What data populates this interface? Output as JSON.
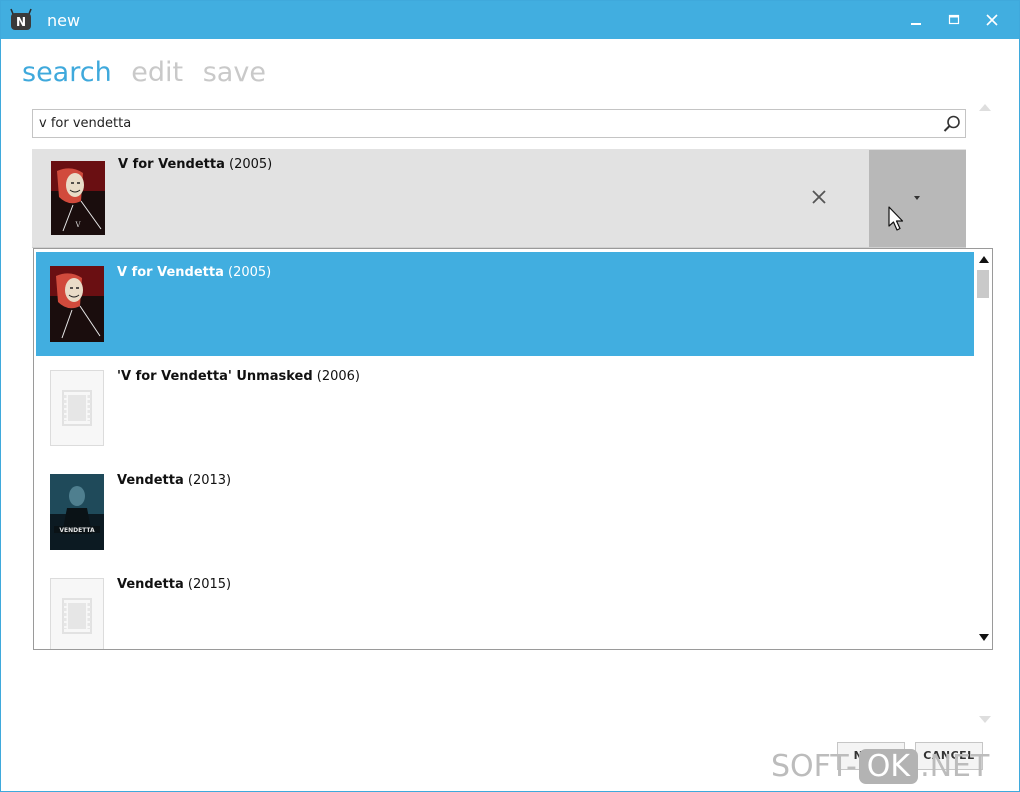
{
  "window": {
    "title": "new",
    "app_icon_letter": "N",
    "title_bar_color": "#41aee0",
    "controls": [
      "minimize-icon",
      "maximize-icon",
      "close-icon"
    ]
  },
  "tabs": [
    {
      "label": "search",
      "active": true
    },
    {
      "label": "edit",
      "active": false
    },
    {
      "label": "save",
      "active": false
    }
  ],
  "search": {
    "value": "v for vendetta",
    "icon": "search-icon"
  },
  "selected_result": {
    "title": "V for Vendetta",
    "year": "(2005)",
    "clear_icon": "close-icon",
    "dropdown_icon": "caret-down-icon"
  },
  "results": [
    {
      "title": "V for Vendetta",
      "year": "(2005)",
      "selected": true,
      "poster": "poster-v-for-vendetta"
    },
    {
      "title": "'V for Vendetta' Unmasked",
      "year": "(2006)",
      "selected": false,
      "poster": "placeholder-film-icon"
    },
    {
      "title": "Vendetta",
      "year": "(2013)",
      "selected": false,
      "poster": "poster-vendetta-2013"
    },
    {
      "title": "Vendetta",
      "year": "(2015)",
      "selected": false,
      "poster": "placeholder-film-icon"
    }
  ],
  "list_scroll": {
    "position_fraction": 0.0
  },
  "buttons": {
    "next": "NEXT",
    "cancel": "CANCEL"
  },
  "watermark": {
    "prefix": "SOFT-",
    "middle": "OK",
    "suffix": ".NET"
  },
  "colors": {
    "accent": "#41aee0",
    "inactive_tab": "#c9c9c9"
  }
}
